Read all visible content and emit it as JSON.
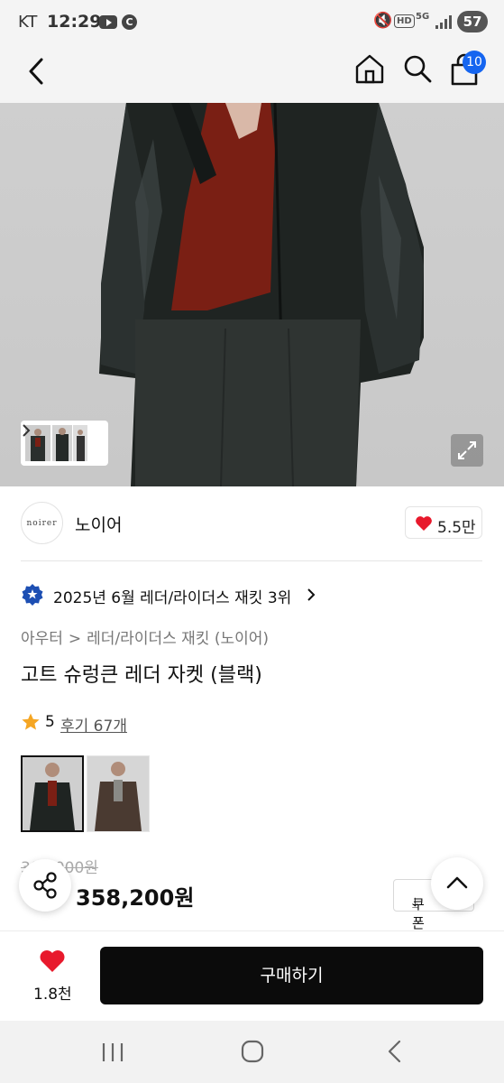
{
  "status_bar": {
    "carrier": "KT",
    "time": "12:29",
    "battery": "57",
    "network": "5G"
  },
  "header": {
    "cart_count": "10"
  },
  "gallery": {
    "thumb_more_icon": "chevron-right-icon",
    "expand_icon": "expand-icon"
  },
  "brand": {
    "logo_text": "noirer",
    "name": "노이어",
    "likes": "5.5만"
  },
  "ranking": {
    "text": "2025년 6월 레더/라이더스 재킷 3위"
  },
  "breadcrumb": {
    "parent": "아우터",
    "child": "레더/라이더스 재킷 (노이어)",
    "separator": ">"
  },
  "product": {
    "title": "고트 슈렁큰 레더 자켓 (블랙)",
    "rating": "5",
    "reviews": "후기 67개"
  },
  "variants": [
    {
      "name": "블랙"
    },
    {
      "name": "브라운"
    }
  ],
  "price": {
    "original": "398,000원",
    "sale": "358,200원",
    "coupon_label": "쿠폰"
  },
  "bottom_bar": {
    "wishlist_count": "1.8천",
    "buy_label": "구매하기"
  },
  "colors": {
    "accent": "#1565f0",
    "heart": "#e8192c",
    "buy_button": "#0b0b0b",
    "star": "#f5a623"
  }
}
